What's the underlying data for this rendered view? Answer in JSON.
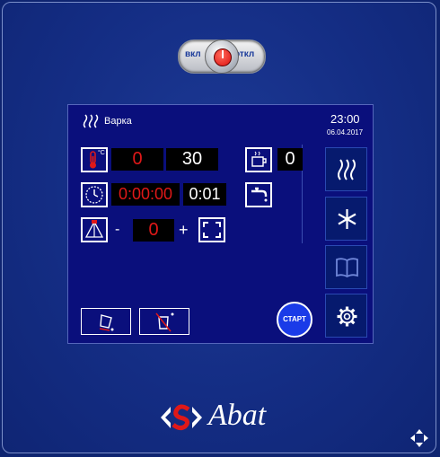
{
  "power": {
    "on_label": "вкл",
    "off_label": "откл"
  },
  "header": {
    "mode_label": "Варка",
    "time": "23:00",
    "date": "06.04.2017"
  },
  "temperature": {
    "unit": "°C",
    "current": "0",
    "target": "30"
  },
  "timer": {
    "elapsed": "0:00:00",
    "set": "0:01"
  },
  "humidity": {
    "minus": "-",
    "value": "0",
    "plus": "+"
  },
  "right_panel": {
    "cup_value": "0"
  },
  "buttons": {
    "start_label": "СТАРТ"
  },
  "brand": {
    "name": "Abat"
  },
  "colors": {
    "background": "#142d84",
    "screen": "#0a0f7c",
    "value_red": "#e01818",
    "start_button": "#1a3be8"
  },
  "icons": [
    "steam-icon",
    "thermometer-icon",
    "clock-icon",
    "humidity-icon",
    "expand-icon",
    "cup-icon",
    "faucet-icon",
    "snowflake-icon",
    "book-icon",
    "gear-icon",
    "pour-icon",
    "washing-icon",
    "navigate-icon"
  ]
}
